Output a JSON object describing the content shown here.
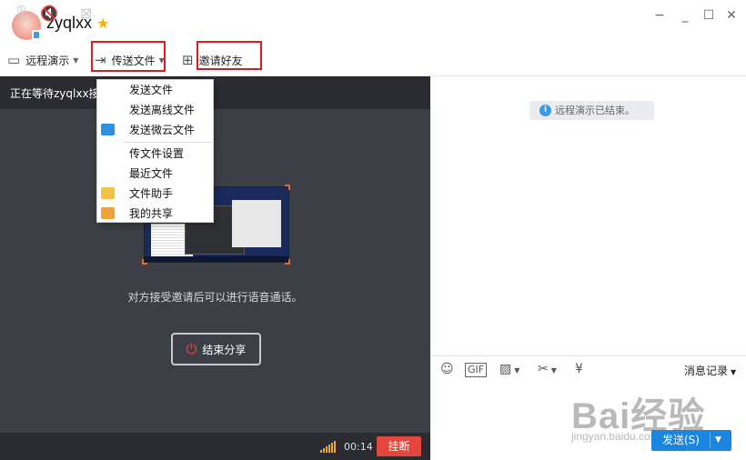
{
  "contact": {
    "name": "zyqlxx"
  },
  "window": {
    "min_icon": "minimize-icon",
    "max_icon": "maximize-icon",
    "close_icon": "close-icon"
  },
  "toolbar": {
    "remote_demo": "远程演示",
    "send_file": "传送文件",
    "invite_friend": "邀请好友"
  },
  "send_menu": {
    "items": [
      {
        "label": "发送文件",
        "icon": ""
      },
      {
        "label": "发送离线文件",
        "icon": ""
      },
      {
        "label": "发送微云文件",
        "icon": "weiyun-cloud-icon"
      },
      {
        "label": "传文件设置",
        "icon": ""
      },
      {
        "label": "最近文件",
        "icon": ""
      },
      {
        "label": "文件助手",
        "icon": "folder-icon"
      },
      {
        "label": "我的共享",
        "icon": "shared-folder-icon"
      }
    ]
  },
  "share_panel": {
    "waiting_text": "正在等待zyqlxx接受邀请",
    "hint": "对方接受邀请后可以进行语音通话。",
    "end_share": "结束分享",
    "timer": "00:14",
    "hangup": "挂断"
  },
  "chat": {
    "notice": "远程演示已结束。",
    "history": "消息记录",
    "send": "发送(S)"
  },
  "watermark": {
    "main": "Bai经验",
    "sub": "jingyan.baidu.com"
  },
  "colors": {
    "accent": "#1b86e0",
    "hangup": "#e2463c",
    "highlight": "#e6161d"
  }
}
